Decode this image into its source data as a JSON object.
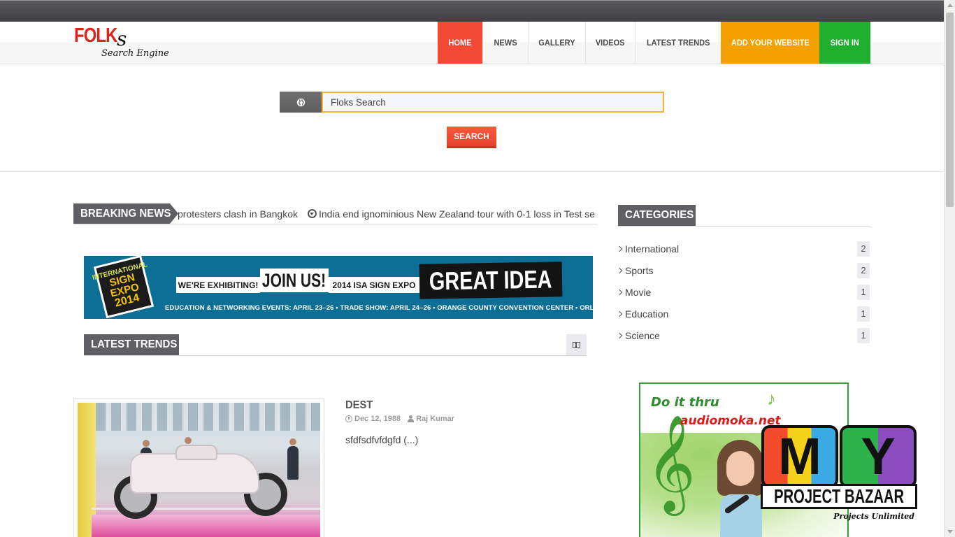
{
  "logo": {
    "main": "FOLK",
    "s": "s",
    "sub": "Search Engine"
  },
  "nav": {
    "home": "HOME",
    "news": "NEWS",
    "gallery": "GALLERY",
    "videos": "VIDEOS",
    "latest_trends": "LATEST TRENDS",
    "add_website": "ADD YOUR WEBSITE",
    "sign_in": "SIGN IN"
  },
  "search": {
    "value": "Floks Search",
    "button": "SEARCH"
  },
  "breaking": {
    "label": "BREAKING NEWS",
    "items": [
      "protesters clash in Bangkok",
      "India end ignominious New Zealand tour with 0-1 loss in Test se"
    ]
  },
  "banner": {
    "seal_line1": "INTERNATIONAL",
    "seal_line2": "SIGN",
    "seal_line3": "EXPO",
    "seal_line4": "2014",
    "exhibiting": "WE'RE EXHIBITING!",
    "join_us": "JOIN US!",
    "isa": "2014 ISA SIGN EXPO",
    "great_idea": "GREAT IDEA",
    "events": "EDUCATION & NETWORKING EVENTS: APRIL 23–26  •  TRADE SHOW: APRIL 24–26  •  ORANGE COUNTY CONVENTION CENTER  •  ORLANDO, FL"
  },
  "latest_trends": {
    "label": "LATEST TRENDS"
  },
  "post": {
    "title": "DEST",
    "date": "Dec 12, 1988",
    "author": "Raj Kumar",
    "excerpt": "sfdfsdfvfdgfd (...)"
  },
  "categories": {
    "label": "CATEGORIES",
    "items": [
      {
        "name": "International",
        "count": "2"
      },
      {
        "name": "Sports",
        "count": "2"
      },
      {
        "name": "Movie",
        "count": "1"
      },
      {
        "name": "Education",
        "count": "1"
      },
      {
        "name": "Science",
        "count": "1"
      }
    ]
  },
  "ad": {
    "doit": "Do it thru",
    "url": "audiomoka.net",
    "note": "♪",
    "clef": "𝄞"
  },
  "myproject": {
    "m": "M",
    "y": "Y",
    "bazaar": "PROJECT BAZAAR",
    "tagline": "Projects Unlimited"
  },
  "colors": {
    "home": "#f24a34",
    "add_website": "#f4a100",
    "sign_in": "#1fae2d",
    "search_border": "#f5b43a",
    "label_bg": "#5f5f64",
    "logo_red": "#e0231b"
  },
  "icons": {
    "globe": "globe-icon",
    "ticker": "circle-arrow-icon",
    "grid": "columns-icon",
    "clock": "clock-icon",
    "user": "user-icon",
    "chevron": "chevron-right-icon"
  }
}
